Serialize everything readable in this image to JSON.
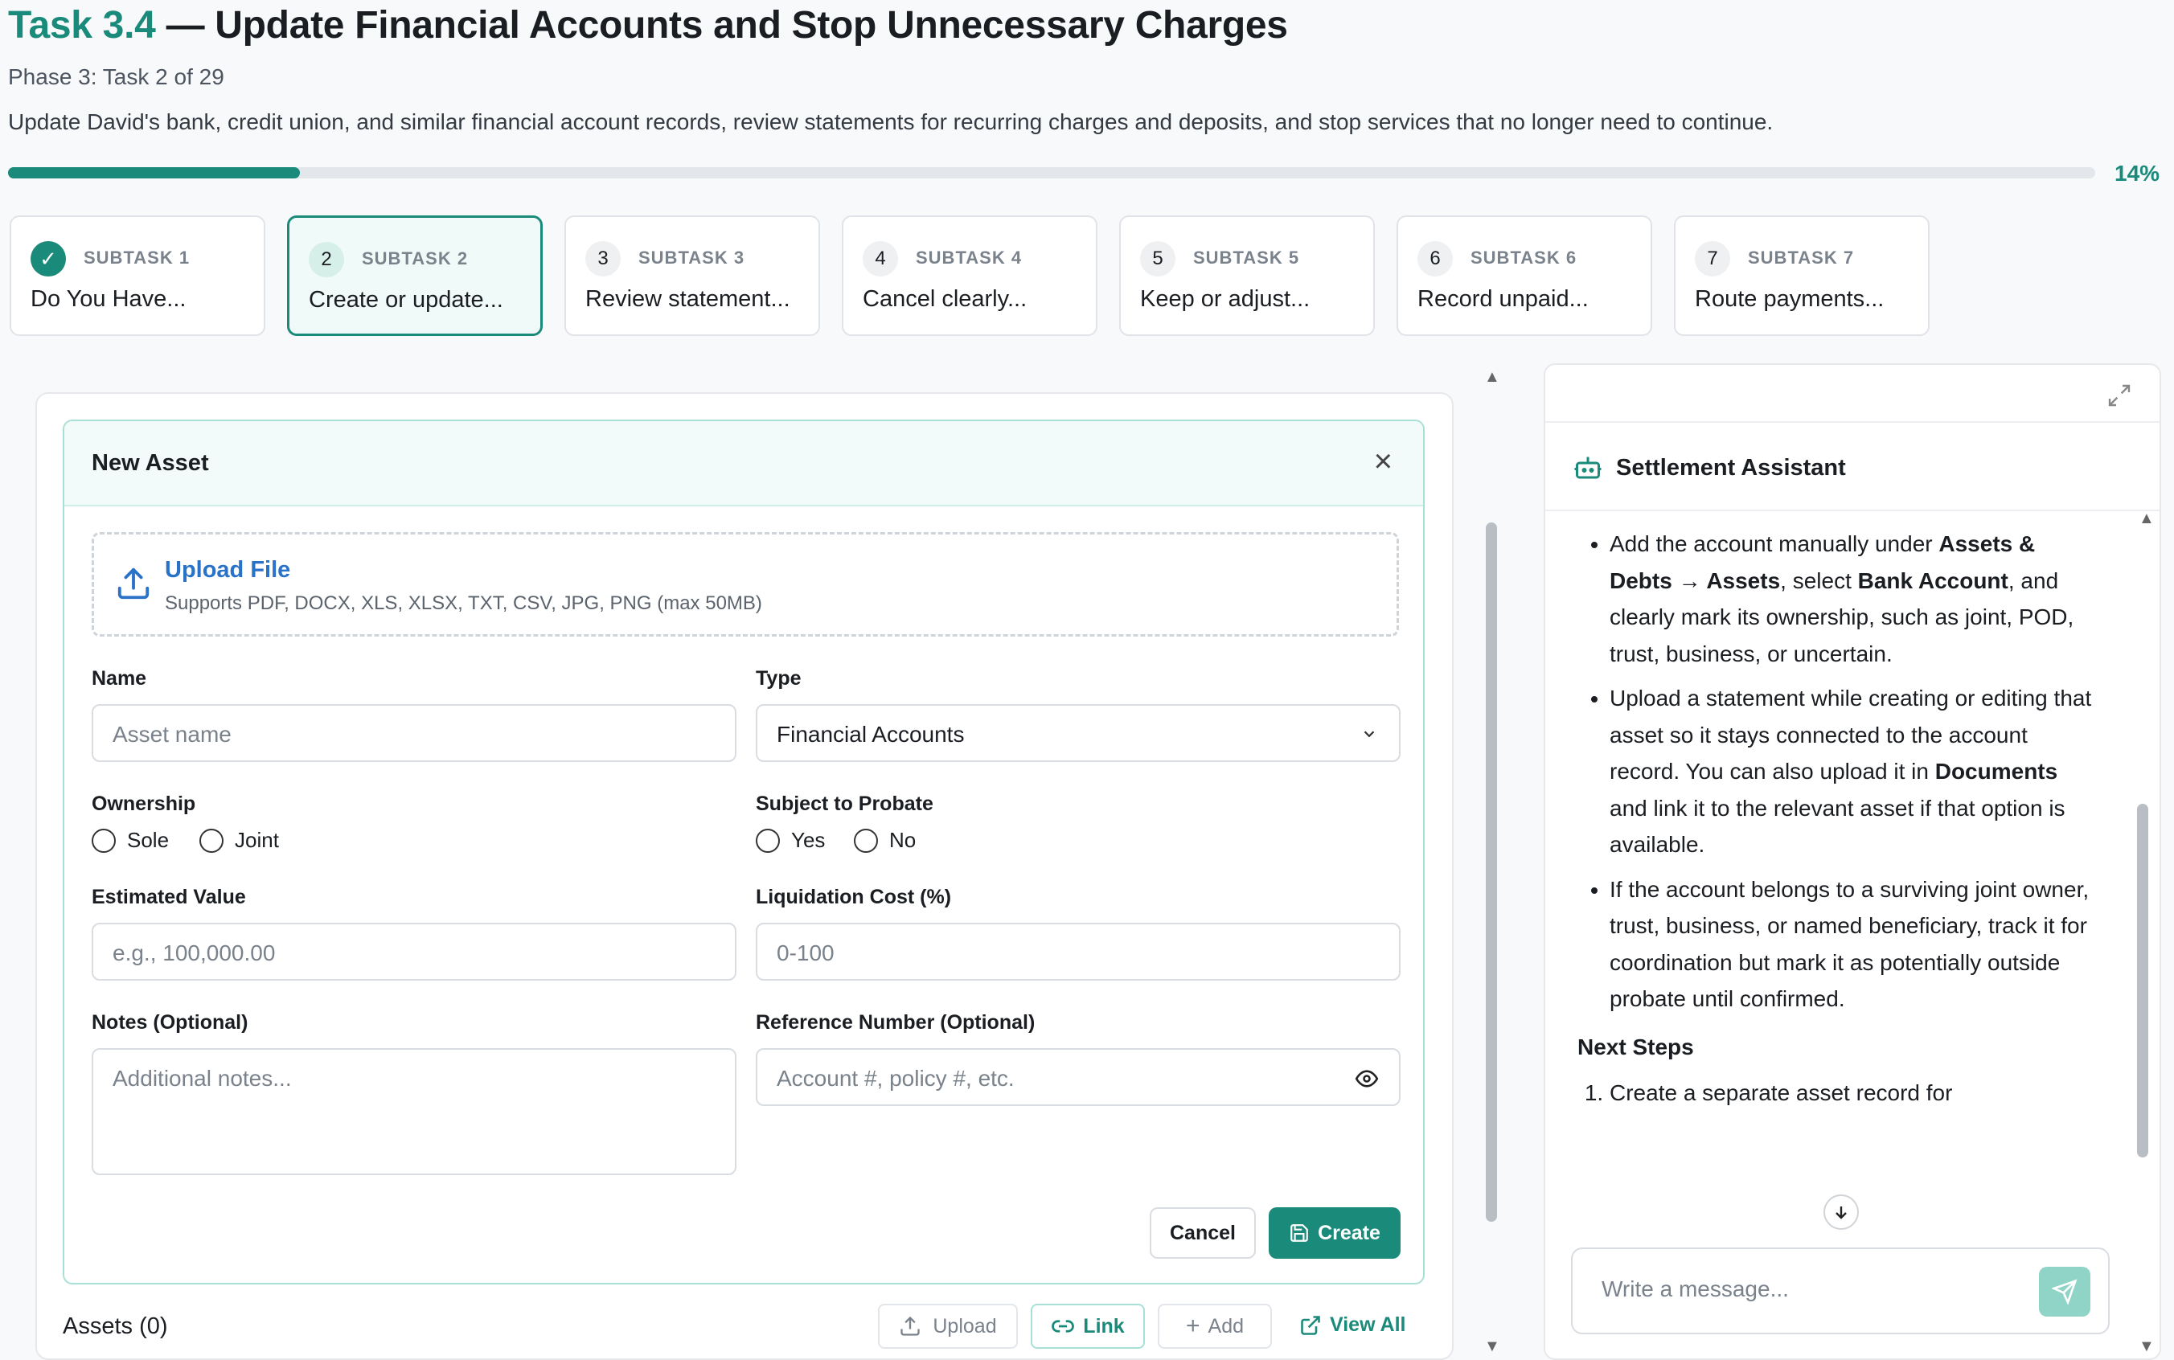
{
  "task": {
    "number": "Task 3.4",
    "title": "— Update Financial Accounts and Stop Unnecessary Charges",
    "phase": "Phase 3: Task 2 of 29",
    "description": "Update David's bank, credit union, and similar financial account records, review statements for recurring charges and deposits, and stop services that no longer need to continue.",
    "progress_percent": 14,
    "progress_label": "14%"
  },
  "subtasks": [
    {
      "badge": "✓",
      "label": "SUBTASK 1",
      "name": "Do You Have...",
      "status": "done"
    },
    {
      "badge": "2",
      "label": "SUBTASK 2",
      "name": "Create or update...",
      "status": "active"
    },
    {
      "badge": "3",
      "label": "SUBTASK 3",
      "name": "Review statement...",
      "status": "pending"
    },
    {
      "badge": "4",
      "label": "SUBTASK 4",
      "name": "Cancel clearly...",
      "status": "pending"
    },
    {
      "badge": "5",
      "label": "SUBTASK 5",
      "name": "Keep or adjust...",
      "status": "pending"
    },
    {
      "badge": "6",
      "label": "SUBTASK 6",
      "name": "Record unpaid...",
      "status": "pending"
    },
    {
      "badge": "7",
      "label": "SUBTASK 7",
      "name": "Route payments...",
      "status": "pending"
    }
  ],
  "form": {
    "title": "New Asset",
    "close": "×",
    "upload_title": "Upload File",
    "upload_hint": "Supports PDF, DOCX, XLS, XLSX, TXT, CSV, JPG, PNG (max 50MB)",
    "name_label": "Name",
    "name_placeholder": "Asset name",
    "type_label": "Type",
    "type_value": "Financial Accounts",
    "ownership_label": "Ownership",
    "ownership_options": [
      "Sole",
      "Joint"
    ],
    "probate_label": "Subject to Probate",
    "probate_options": [
      "Yes",
      "No"
    ],
    "value_label": "Estimated Value",
    "value_placeholder": "e.g., 100,000.00",
    "liquidation_label": "Liquidation Cost (%)",
    "liquidation_placeholder": "0-100",
    "notes_label": "Notes (Optional)",
    "notes_placeholder": "Additional notes...",
    "reference_label": "Reference Number (Optional)",
    "reference_placeholder": "Account #, policy #, etc.",
    "cancel": "Cancel",
    "create": "Create"
  },
  "assets": {
    "title": "Assets (0)",
    "upload": "Upload",
    "link": "Link",
    "add": "Add",
    "view_all": "View All"
  },
  "assistant": {
    "name": "Settlement Assistant",
    "bullet1_a": "Add the account manually under ",
    "bullet1_b": "Assets & Debts → Assets",
    "bullet1_c": ", select ",
    "bullet1_d": "Bank Account",
    "bullet1_e": ", and clearly mark its ownership, such as joint, POD, trust, business, or uncertain.",
    "bullet2_a": "Upload a statement while creating or editing that asset so it stays connected to the account record. You can also upload it in ",
    "bullet2_b": "Documents",
    "bullet2_c": " and link it to the relevant asset if that option is available.",
    "bullet3": "If the account belongs to a surviving joint owner, trust, business, or named beneficiary, track it for coordination but mark it as potentially outside probate until confirmed.",
    "next_steps": "Next Steps",
    "step1": "Create a separate asset record for",
    "message_placeholder": "Write a message..."
  },
  "colors": {
    "accent": "#1a8a7a",
    "link_blue": "#2a72c8"
  }
}
